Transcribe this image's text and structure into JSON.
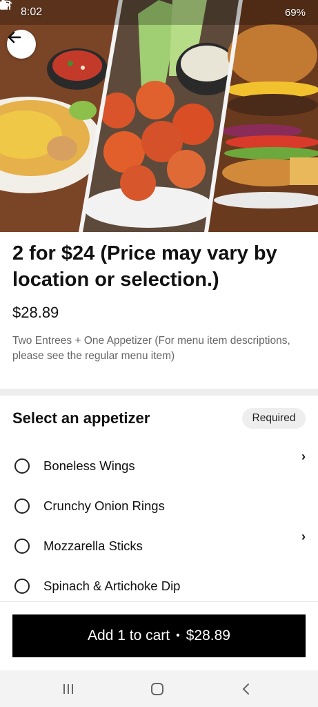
{
  "status": {
    "time": "8:02",
    "battery": "69%"
  },
  "item": {
    "title": "2 for $24 (Price may vary by location or selection.)",
    "price": "$28.89",
    "description": "Two Entrees + One Appetizer (For menu item descriptions, please see the regular menu item)"
  },
  "appetizer": {
    "heading": "Select an appetizer",
    "badge": "Required",
    "options": [
      {
        "label": "Boneless Wings",
        "has_chevron": true
      },
      {
        "label": "Crunchy Onion Rings",
        "has_chevron": false
      },
      {
        "label": "Mozzarella Sticks",
        "has_chevron": true
      },
      {
        "label": "Spinach & Artichoke Dip",
        "has_chevron": false
      }
    ]
  },
  "cart": {
    "label": "Add 1 to cart",
    "separator": "•",
    "price": "$28.89"
  },
  "icons": {
    "back": "arrow-left-icon",
    "chevron": "chevron-right-icon",
    "nav": [
      "recent-apps-icon",
      "home-icon",
      "back-nav-icon"
    ]
  }
}
